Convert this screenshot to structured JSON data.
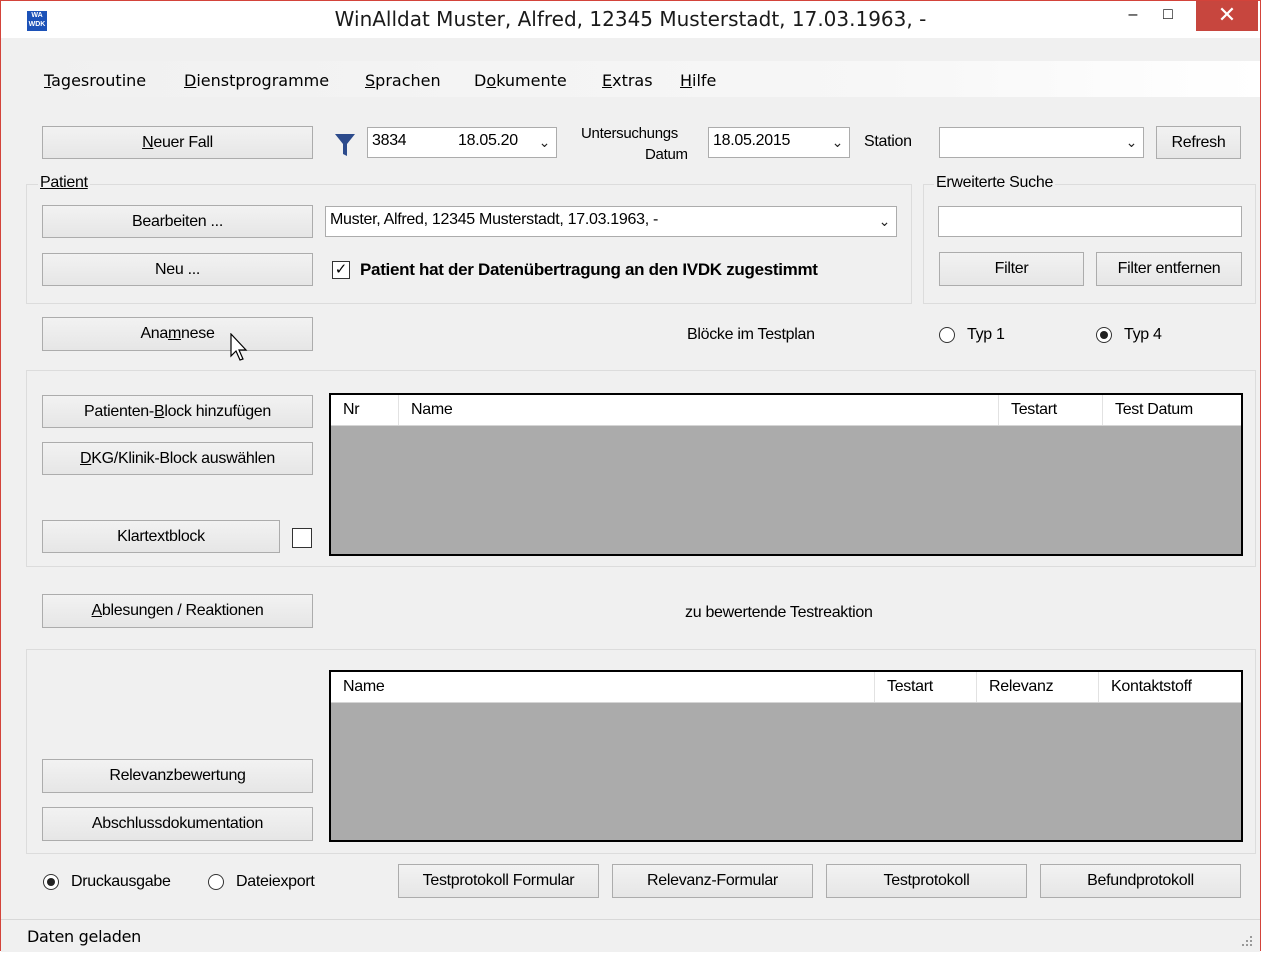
{
  "window": {
    "title": "WinAlldat Muster, Alfred, 12345 Musterstadt, 17.03.1963, -",
    "icon_text": "WA\nWDK",
    "minimize_glyph": "–",
    "maximize_glyph": "□",
    "close_glyph": "✕"
  },
  "menu": [
    {
      "pre": "",
      "acc": "T",
      "post": "agesroutine"
    },
    {
      "pre": "",
      "acc": "D",
      "post": "ienstprogramme"
    },
    {
      "pre": "",
      "acc": "S",
      "post": "prachen"
    },
    {
      "pre": "D",
      "acc": "o",
      "post": "kumente"
    },
    {
      "pre": "",
      "acc": "E",
      "post": "xtras"
    },
    {
      "pre": "",
      "acc": "H",
      "post": "ilfe"
    }
  ],
  "toolbar": {
    "new_case_pre": "",
    "new_case_acc": "N",
    "new_case_post": "euer Fall",
    "case_number": "3834",
    "case_date": "18.05.20",
    "exam_label_1": "Untersuchungs",
    "exam_label_2": "Datum",
    "exam_date": "18.05.2015",
    "station_label": "Station",
    "station_value": "",
    "refresh_label": "Refresh"
  },
  "patient": {
    "group_label": "Patient",
    "edit_label": "Bearbeiten ...",
    "new_label": "Neu ...",
    "selected": "Muster, Alfred, 12345 Musterstadt, 17.03.1963, -",
    "consent_label": "Patient hat der Datenübertragung an den IVDK zugestimmt",
    "consent_checked": true
  },
  "search": {
    "group_label": "Erweiterte Suche",
    "value": "",
    "filter_label": "Filter",
    "remove_filter_label": "Filter entfernen"
  },
  "anamnese": {
    "pre": "Ana",
    "acc": "m",
    "post": "nese"
  },
  "testplan": {
    "label": "Blöcke im Testplan",
    "type1_label": "Typ 1",
    "type4_label": "Typ 4",
    "selected": "Typ 4"
  },
  "blocks": {
    "add_patient_block": {
      "pre": "Patienten-",
      "acc": "B",
      "post": "lock hinzufügen"
    },
    "select_dkg_block": {
      "pre": "",
      "acc": "D",
      "post": "KG/Klinik-Block auswählen"
    },
    "cleartext_block": "Klartextblock",
    "columns": [
      "Nr",
      "Name",
      "Testart",
      "Test Datum"
    ]
  },
  "readings": {
    "button": {
      "pre": "",
      "acc": "A",
      "post": "blesungen / Reaktionen"
    },
    "label": "zu bewertende Testreaktion",
    "columns": [
      "Name",
      "Testart",
      "Relevanz",
      "Kontaktstoff"
    ],
    "relevance_eval": "Relevanzbewertung",
    "final_doc": "Abschlussdokumentation"
  },
  "output": {
    "print_label": "Druckausgabe",
    "export_label": "Dateiexport",
    "selected": "Druckausgabe",
    "btn_test_form": "Testprotokoll Formular",
    "btn_relevance_form": "Relevanz-Formular",
    "btn_test_protocol": "Testprotokoll",
    "btn_findings": "Befundprotokoll"
  },
  "status": {
    "text": "Daten geladen"
  },
  "colors": {
    "close_button": "#c7463e",
    "grid_background": "#ababab",
    "filter_icon": "#2c4b8c"
  }
}
